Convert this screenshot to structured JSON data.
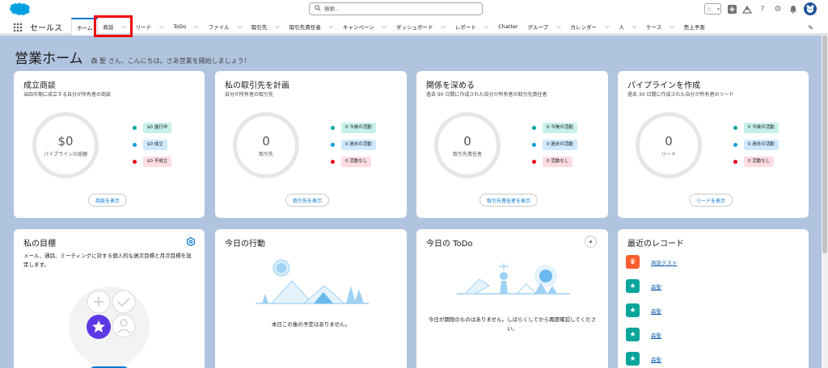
{
  "topbar": {
    "search_placeholder": "検索..."
  },
  "nav": {
    "app_name": "セールス",
    "tabs": [
      {
        "label": "ホーム",
        "dropdown": false,
        "active": true
      },
      {
        "label": "商談",
        "dropdown": true
      },
      {
        "label": "リード",
        "dropdown": true
      },
      {
        "label": "ToDo",
        "dropdown": true
      },
      {
        "label": "ファイル",
        "dropdown": true
      },
      {
        "label": "取引先",
        "dropdown": true
      },
      {
        "label": "取引先責任者",
        "dropdown": true
      },
      {
        "label": "キャンペーン",
        "dropdown": true
      },
      {
        "label": "ダッシュボード",
        "dropdown": true
      },
      {
        "label": "レポート",
        "dropdown": true
      },
      {
        "label": "Chatter",
        "dropdown": false
      },
      {
        "label": "グループ",
        "dropdown": true
      },
      {
        "label": "カレンダー",
        "dropdown": true
      },
      {
        "label": "人",
        "dropdown": true
      },
      {
        "label": "ケース",
        "dropdown": true
      },
      {
        "label": "売上予測",
        "dropdown": false
      }
    ],
    "highlighted_tab": "商談"
  },
  "header": {
    "title": "営業ホーム",
    "greeting": "森 聖 さん、こんにちは。さあ営業を開始しましょう！"
  },
  "cards": {
    "deals": {
      "title": "成立商談",
      "subtitle": "当四半期に成立する自分が所有者の商談",
      "ring_value": "$0",
      "ring_label": "パイプラインの総額",
      "legend": [
        "$0 進行中",
        "$0 成立",
        "$0 不成立"
      ],
      "button": "商談を表示"
    },
    "accounts": {
      "title": "私の取引先を計画",
      "subtitle": "自分が所有者の取引先",
      "ring_value": "0",
      "ring_label": "取引先",
      "legend": [
        "0 今後の活動",
        "0 過去の活動",
        "0 活動なし"
      ],
      "button": "取引先を表示"
    },
    "contacts": {
      "title": "関係を深める",
      "subtitle": "過去 90 日間に作成された自分が所有者の取引先責任者",
      "ring_value": "0",
      "ring_label": "取引先責任者",
      "legend": [
        "0 今後の活動",
        "0 過去の活動",
        "0 活動なし"
      ],
      "button": "取引先責任者を表示"
    },
    "pipeline": {
      "title": "パイプラインを作成",
      "subtitle": "過去 30 日間に作成された自分が所有者のリード",
      "ring_value": "0",
      "ring_label": "リード",
      "legend": [
        "0 今後の活動",
        "0 過去の活動",
        "0 活動なし"
      ],
      "button": "リードを表示"
    },
    "goals": {
      "title": "私の目標",
      "description": "メール、通話、ミーティングに対する個人的な週次目標と月次目標を設定します。"
    },
    "events": {
      "title": "今日の行動",
      "empty": "本日この後の予定はありません。"
    },
    "todo": {
      "title": "今日の ToDo",
      "empty": "今日が期限のものはありません。しばらくしてから再度確認してください。"
    },
    "recent": {
      "title": "最近のレコード",
      "items": [
        {
          "label": "商談テスト",
          "icon": "crown-icon",
          "color": "#ff5d2d"
        },
        {
          "label": "森聖",
          "icon": "star-icon",
          "color": "#06a59a"
        },
        {
          "label": "森聖",
          "icon": "star-icon",
          "color": "#06a59a"
        },
        {
          "label": "森聖",
          "icon": "star-icon",
          "color": "#06a59a"
        },
        {
          "label": "森聖",
          "icon": "star-icon",
          "color": "#06a59a"
        }
      ]
    }
  },
  "colors": {
    "accent": "#0176d3",
    "teal": "#06a59a",
    "blue": "#0b9ed5",
    "red": "#ea001e",
    "pill_teal_bg": "#c7f0eb",
    "pill_blue_bg": "#cfe9fe",
    "pill_red_bg": "#fddde3"
  }
}
